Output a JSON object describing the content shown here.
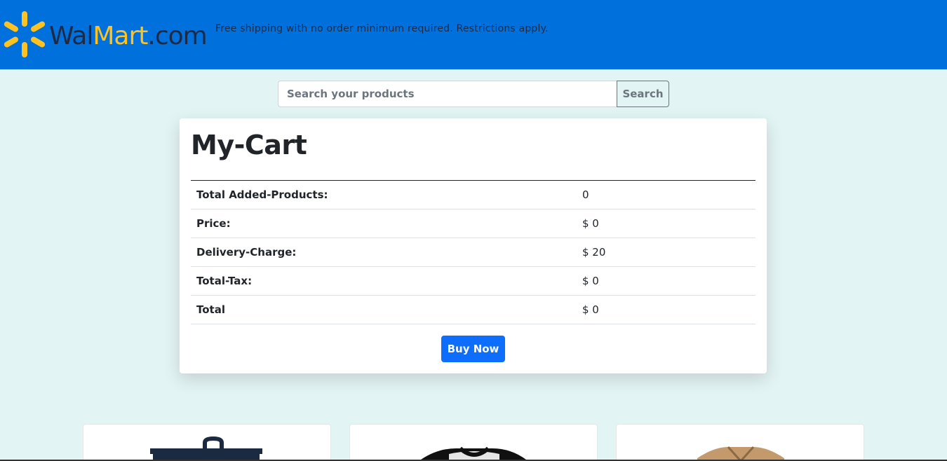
{
  "header": {
    "logo": {
      "part1": "Wal",
      "part2": "Mart",
      "part3": ".com",
      "icon": "spark-icon"
    },
    "tagline": "Free shipping with no order minimum required. Restrictions apply.",
    "color": "#0071dc",
    "accent": "#ffc220"
  },
  "search": {
    "placeholder": "Search your products",
    "value": "",
    "button_label": "Search"
  },
  "cart": {
    "title": "My-Cart",
    "rows": [
      {
        "label": "Total Added-Products:",
        "value": "0"
      },
      {
        "label": "Price:",
        "value": "$ 0"
      },
      {
        "label": "Delivery-Charge:",
        "value": "$ 20"
      },
      {
        "label": "Total-Tax:",
        "value": "$ 0"
      },
      {
        "label": "Total",
        "value": "$ 0"
      }
    ],
    "buy_label": "Buy Now",
    "buy_color": "#0d6efd"
  },
  "products": [
    {
      "icon": "bag-image"
    },
    {
      "icon": "shirt-image"
    },
    {
      "icon": "jacket-image"
    }
  ],
  "background": "#e3f4f4"
}
